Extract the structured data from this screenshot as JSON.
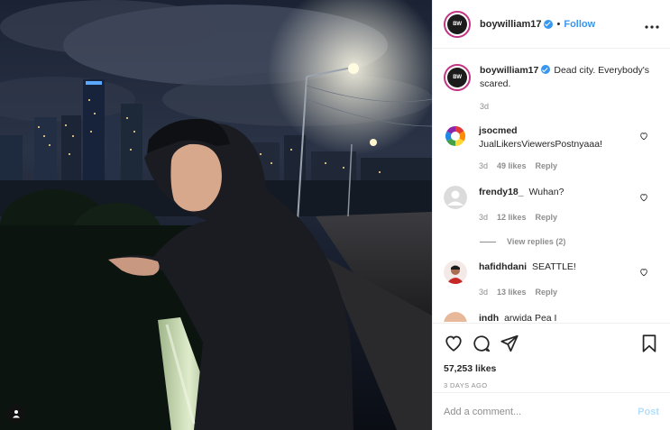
{
  "post": {
    "author": "boywilliam17",
    "avatar_text": "BW",
    "follow_label": "Follow",
    "separator": "•",
    "more_icon": "more-dots-icon"
  },
  "caption": {
    "user": "boywilliam17",
    "text": "Dead city. Everybody's scared.",
    "time": "3d"
  },
  "comments": [
    {
      "user": "jsocmed",
      "text": "JualLikersViewersPostnyaaa!",
      "time": "3d",
      "likes": "49 likes",
      "reply": "Reply"
    },
    {
      "user": "frendy18_",
      "text": "Wuhan?",
      "time": "3d",
      "likes": "12 likes",
      "reply": "Reply",
      "view_replies": "View replies (2)"
    },
    {
      "user": "hafidhdani",
      "text": "SEATTLE!",
      "time": "3d",
      "likes": "13 likes",
      "reply": "Reply"
    },
    {
      "user": "indh",
      "text": "arwida Pea I",
      "time": "",
      "likes": "",
      "reply": ""
    }
  ],
  "likes_count": "57,253 likes",
  "posted_ago": "3 DAYS AGO",
  "comment_box": {
    "placeholder": "Add a comment...",
    "post_label": "Post"
  },
  "colors": {
    "accent": "#3897f0",
    "post_disabled": "#b2dffc",
    "muted": "#8e8e8e"
  }
}
